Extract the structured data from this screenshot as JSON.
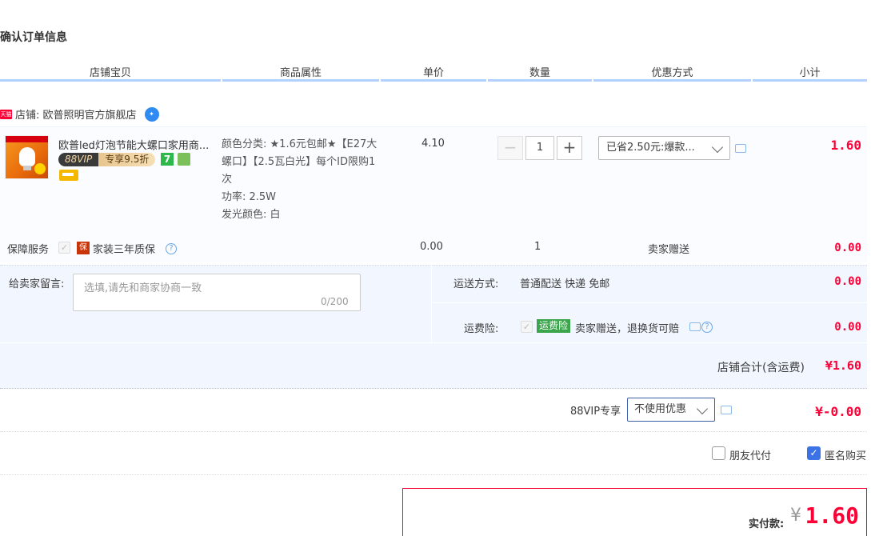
{
  "page_title": "确认订单信息",
  "columns": [
    "店铺宝贝",
    "商品属性",
    "单价",
    "数量",
    "优惠方式",
    "小计"
  ],
  "shop": {
    "badge": "天猫",
    "label": "店铺: 欧普照明官方旗舰店"
  },
  "item": {
    "name": "欧普led灯泡节能大螺口家用商...",
    "vip_a": "88VIP",
    "vip_b": "专享9.5折",
    "seven_badge": "7",
    "attrs": [
      "颜色分类: ★1.6元包邮★【E27大螺口】【2.5瓦白光】每个ID限购1次",
      "功率: 2.5W",
      "发光颜色: 白"
    ],
    "unit_price": "4.10",
    "quantity": "1",
    "qty_minus": "−",
    "qty_plus": "+",
    "discount": "已省2.50元:爆款...",
    "subtotal": "1.60"
  },
  "service": {
    "label": "保障服务",
    "check": "✓",
    "badge": "保",
    "text": "家装三年质保",
    "help": "?",
    "price": "0.00",
    "qty": "1",
    "mode": "卖家赠送",
    "amount": "0.00"
  },
  "message": {
    "label": "给卖家留言:",
    "placeholder": "选填,请先和商家协商一致",
    "count": "0/200"
  },
  "shipping": {
    "label": "运送方式:",
    "value": "普通配送 快递 免邮",
    "amount": "0.00"
  },
  "insurance": {
    "label": "运费险:",
    "check": "✓",
    "badge": "运费险",
    "text": "卖家赠送，退换货可赔",
    "help": "?",
    "amount": "0.00"
  },
  "shop_total": {
    "label": "店铺合计(含运费)",
    "amount": "¥1.60"
  },
  "vip": {
    "label": "88VIP专享",
    "select": "不使用优惠",
    "amount": "¥-0.00"
  },
  "options": {
    "friend_pay": "朋友代付",
    "anonymous": "匿名购买",
    "anon_check": "✓"
  },
  "pay": {
    "label": "实付款:",
    "yen": "¥",
    "amount": "1.60"
  }
}
